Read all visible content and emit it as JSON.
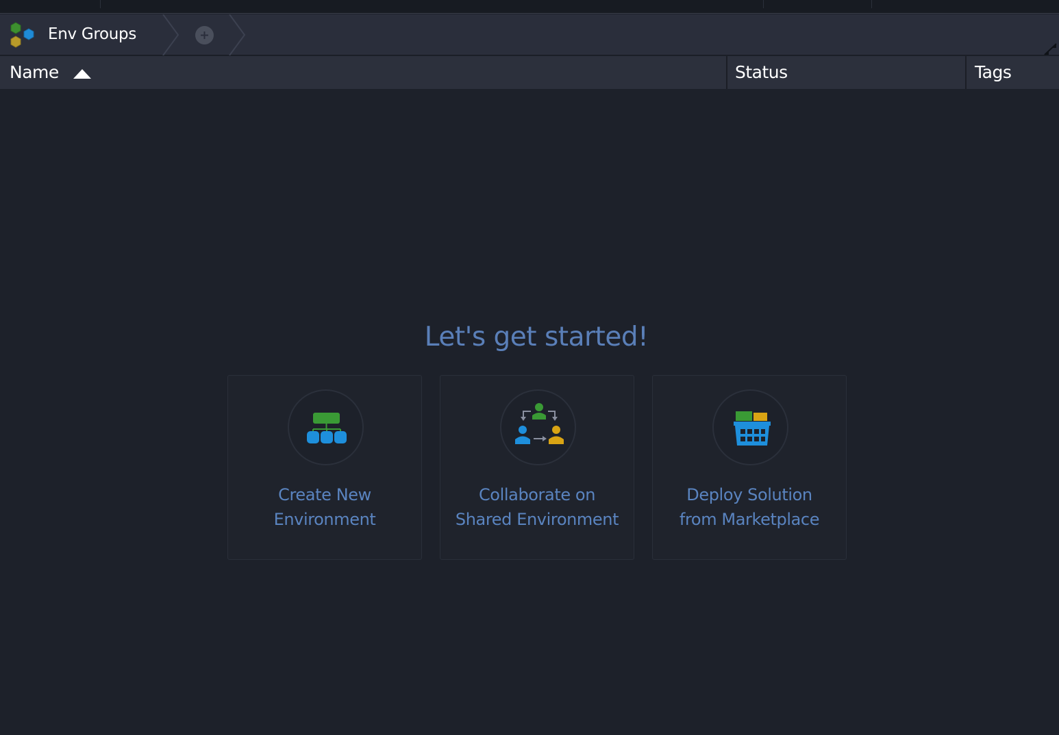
{
  "breadcrumb": {
    "title": "Env Groups",
    "add_icon": "plus-circle-icon",
    "logo_icon": "hexagon-cluster-logo"
  },
  "table": {
    "columns": [
      {
        "label": "Name",
        "sorted": "ascending"
      },
      {
        "label": "Status"
      },
      {
        "label": "Tags"
      }
    ]
  },
  "empty_state": {
    "heading": "Let's get started!",
    "cards": [
      {
        "line1": "Create New",
        "line2": "Environment",
        "icon": "environment-topology-icon"
      },
      {
        "line1": "Collaborate on",
        "line2": "Shared Environment",
        "icon": "collaborate-users-icon"
      },
      {
        "line1": "Deploy Solution",
        "line2": "from Marketplace",
        "icon": "marketplace-basket-icon"
      }
    ]
  },
  "colors": {
    "background": "#1d212a",
    "header": "#2c303c",
    "accent_text": "#5a84c0",
    "green": "#3a9a35",
    "blue": "#1e8fdc",
    "yellow": "#d9a414"
  }
}
